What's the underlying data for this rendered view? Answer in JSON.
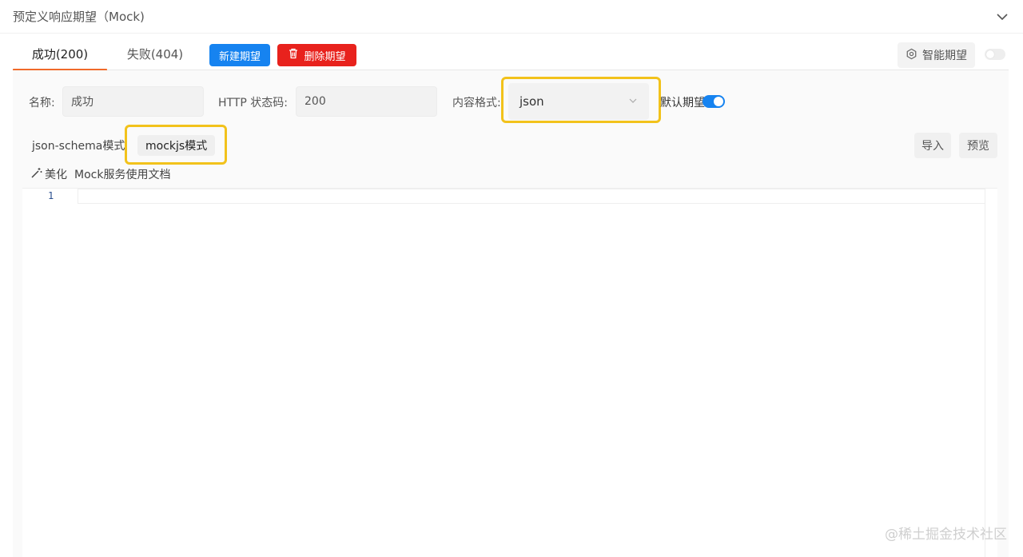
{
  "section": {
    "title": "预定义响应期望（Mock)"
  },
  "tabs": [
    {
      "label": "成功(200)",
      "active": true
    },
    {
      "label": "失败(404)",
      "active": false
    }
  ],
  "toolbar": {
    "new_label": "新建期望",
    "delete_label": "删除期望",
    "ai_label": "智能期望",
    "ai_enabled": false
  },
  "form": {
    "name_label": "名称:",
    "name_value": "成功",
    "status_label": "HTTP 状态码:",
    "status_value": "200",
    "format_label": "内容格式:",
    "format_value": "json",
    "default_label": "默认期望",
    "default_enabled": true
  },
  "modes": [
    {
      "label": "json-schema模式",
      "active": false
    },
    {
      "label": "mockjs模式",
      "active": true
    }
  ],
  "actions": {
    "import_label": "导入",
    "preview_label": "预览",
    "beautify_label": "美化",
    "docs_label": "Mock服务使用文档"
  },
  "editor": {
    "lines": [
      "1"
    ]
  },
  "watermark": "@稀土掘金技术社区",
  "colors": {
    "primary": "#1683f0",
    "danger": "#e8221d",
    "tab_accent": "#f06a2a",
    "highlight": "#f2c21b"
  }
}
